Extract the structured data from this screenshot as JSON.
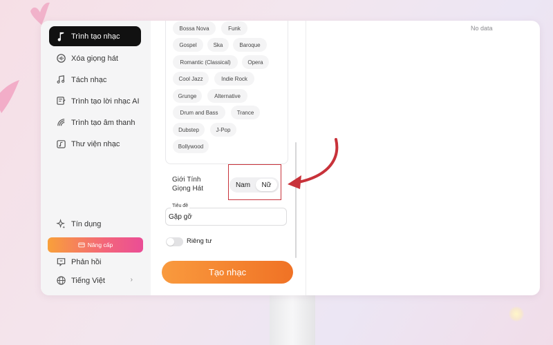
{
  "sidebar": {
    "nav": [
      {
        "label": "Trình tạo nhạc",
        "icon": "music-note-icon",
        "active": true
      },
      {
        "label": "Xóa giọng hát",
        "icon": "vocal-remover-icon",
        "active": false
      },
      {
        "label": "Tách nhạc",
        "icon": "music-split-icon",
        "active": false
      },
      {
        "label": "Trình tạo lời nhạc AI",
        "icon": "lyrics-generator-icon",
        "active": false
      },
      {
        "label": "Trình tạo âm thanh",
        "icon": "sound-generator-icon",
        "active": false
      },
      {
        "label": "Thư viện nhạc",
        "icon": "music-library-icon",
        "active": false
      }
    ],
    "credits_label": "Tín dụng",
    "upgrade_label": "Nâng cấp",
    "feedback_label": "Phản hồi",
    "language_label": "Tiếng Việt"
  },
  "genres": [
    [
      "Bossa Nova",
      "Funk"
    ],
    [
      "Gospel",
      "Ska",
      "Baroque"
    ],
    [
      "Romantic (Classical)",
      "Opera"
    ],
    [
      "Cool Jazz",
      "Indie Rock"
    ],
    [
      "Grunge",
      "Alternative"
    ],
    [
      "Drum and Bass",
      "Trance"
    ],
    [
      "Dubstep",
      "J-Pop"
    ],
    [
      "Bollywood"
    ]
  ],
  "voice_gender": {
    "label_line1": "Giới Tính",
    "label_line2": "Giọng Hát",
    "options": [
      "Nam",
      "Nữ"
    ],
    "selected": "Nữ"
  },
  "title_field": {
    "legend": "Tiêu đề",
    "value": "Gặp gỡ"
  },
  "private": {
    "label": "Riêng tư",
    "on": false
  },
  "create_button": "Tạo nhạc",
  "results": {
    "empty_text": "No data"
  },
  "colors": {
    "accent": "#f07225",
    "annotation_red": "#c8323a",
    "active_nav": "#111111"
  }
}
